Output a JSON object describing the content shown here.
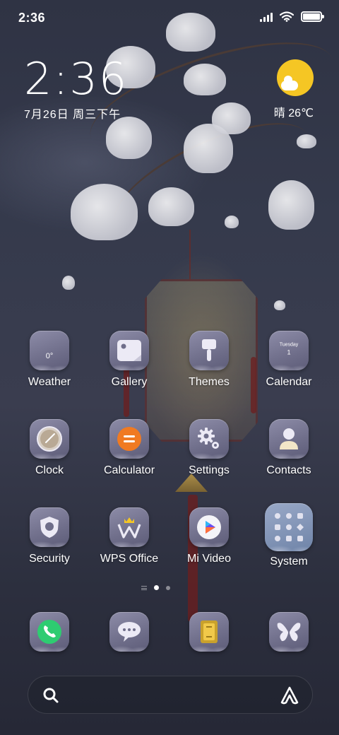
{
  "status_bar": {
    "time": "2:36"
  },
  "clock_widget": {
    "time": "2:36",
    "date": "7月26日 周三下午"
  },
  "weather_widget": {
    "text": "晴 26℃",
    "icon": "sunny-partly-cloudy-icon"
  },
  "apps": [
    {
      "label": "Weather",
      "icon": "weather-icon",
      "icon_text": "0°"
    },
    {
      "label": "Gallery",
      "icon": "gallery-icon"
    },
    {
      "label": "Themes",
      "icon": "themes-brush-icon"
    },
    {
      "label": "Calendar",
      "icon": "calendar-icon",
      "icon_day": "Tuesday",
      "icon_date": "1"
    },
    {
      "label": "Clock",
      "icon": "clock-icon"
    },
    {
      "label": "Calculator",
      "icon": "calculator-icon"
    },
    {
      "label": "Settings",
      "icon": "gear-icon"
    },
    {
      "label": "Contacts",
      "icon": "contacts-person-icon"
    },
    {
      "label": "Security",
      "icon": "shield-icon"
    },
    {
      "label": "WPS Office",
      "icon": "wps-office-icon"
    },
    {
      "label": "Mi Video",
      "icon": "play-icon"
    },
    {
      "label": "System",
      "icon": "system-folder-icon"
    }
  ],
  "dock": [
    {
      "icon": "phone-icon"
    },
    {
      "icon": "messages-icon"
    },
    {
      "icon": "file-manager-icon"
    },
    {
      "icon": "butterfly-icon"
    }
  ],
  "colors": {
    "accent_yellow": "#f5c624",
    "phone_green": "#2ecc71",
    "calculator_orange": "#f07a22"
  }
}
